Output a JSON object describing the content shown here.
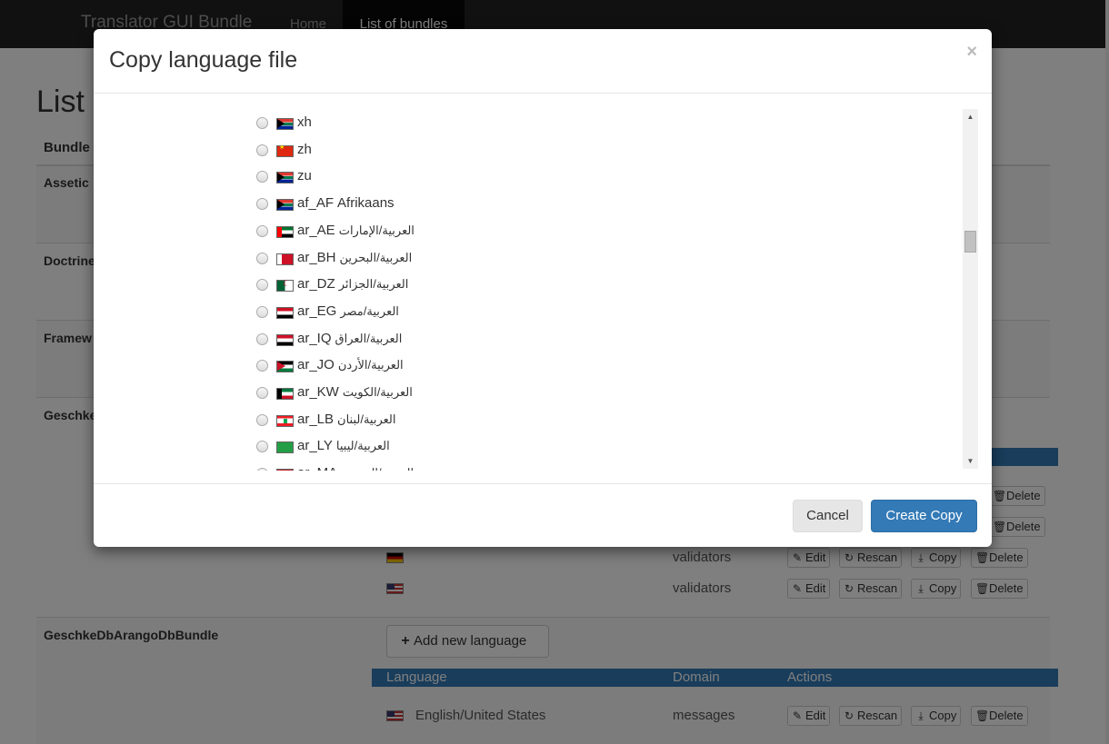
{
  "navbar": {
    "brand": "Translator GUI Bundle",
    "home": "Home",
    "bundles": "List of bundles"
  },
  "page": {
    "title": "List o",
    "bundle_col": "Bundle"
  },
  "bundles": [
    {
      "name": "Assetic"
    },
    {
      "name": "Doctrine"
    },
    {
      "name": "Framew"
    },
    {
      "name": "Geschke"
    },
    {
      "name": "GeschkeDbArangoDbBundle"
    }
  ],
  "table": {
    "col_language": "Language",
    "col_domain": "Domain",
    "col_actions": "Actions",
    "add_language": "Add new language",
    "rows_partial": [
      {
        "flag": "de",
        "domain": "validators"
      },
      {
        "flag": "us",
        "domain": "validators"
      }
    ],
    "row_arango": {
      "language": "English/United States",
      "domain": "messages"
    },
    "actions": {
      "edit": "Edit",
      "rescan": "Rescan",
      "copy": "Copy",
      "delete": "Delete"
    }
  },
  "modal": {
    "title": "Copy language file",
    "close": "×",
    "cancel": "Cancel",
    "create": "Create Copy",
    "languages": [
      {
        "code": "xh",
        "name": "",
        "flag": "za"
      },
      {
        "code": "zh",
        "name": "",
        "flag": "cn"
      },
      {
        "code": "zu",
        "name": "",
        "flag": "za"
      },
      {
        "code": "af_AF",
        "name": "Afrikaans",
        "flag": "za"
      },
      {
        "code": "ar_AE",
        "name": "العربية/الإمارات",
        "flag": "ae"
      },
      {
        "code": "ar_BH",
        "name": "العربية/البحرين",
        "flag": "bh"
      },
      {
        "code": "ar_DZ",
        "name": "العربية/الجزائر",
        "flag": "dz"
      },
      {
        "code": "ar_EG",
        "name": "العربية/مصر",
        "flag": "eg"
      },
      {
        "code": "ar_IQ",
        "name": "العربية/العراق",
        "flag": "iq"
      },
      {
        "code": "ar_JO",
        "name": "العربية/الأردن",
        "flag": "jo"
      },
      {
        "code": "ar_KW",
        "name": "العربية/الكويت",
        "flag": "kw"
      },
      {
        "code": "ar_LB",
        "name": "العربية/لبنان",
        "flag": "lb"
      },
      {
        "code": "ar_LY",
        "name": "العربية/ليبيا",
        "flag": "ly"
      },
      {
        "code": "ar_MA",
        "name": "العربية/المغرب",
        "flag": "ma"
      }
    ]
  }
}
